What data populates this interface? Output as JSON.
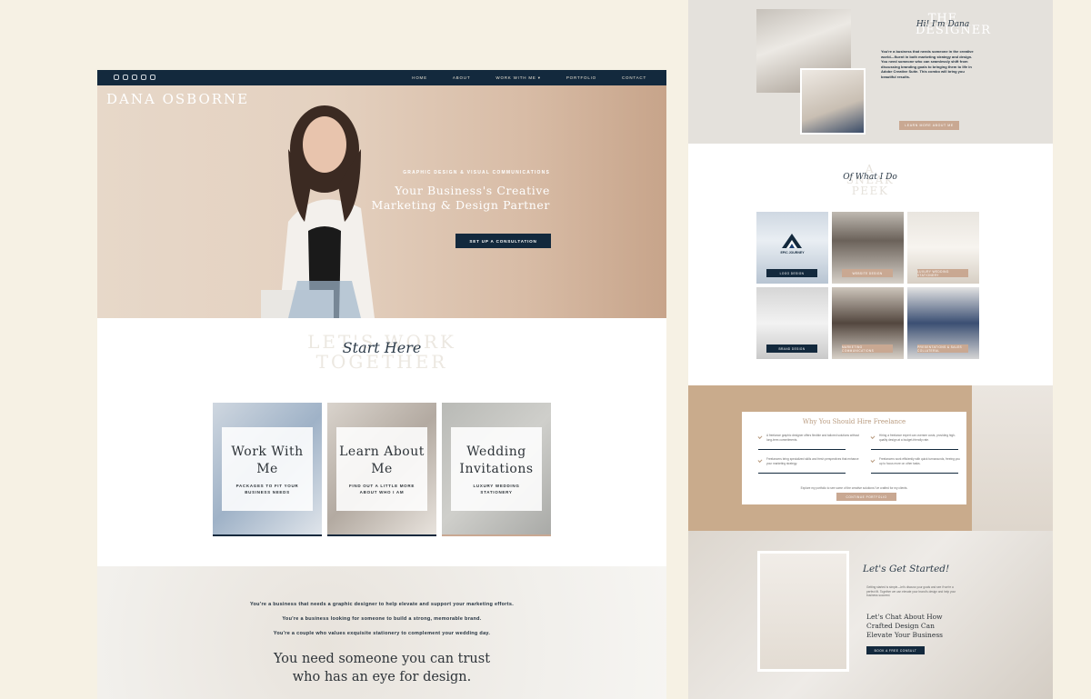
{
  "left_site": {
    "brand": "DANA OSBORNE",
    "nav": [
      "HOME",
      "ABOUT",
      "WORK WITH ME ▾",
      "PORTFOLIO",
      "CONTACT"
    ],
    "social_icons": [
      "instagram-icon",
      "pinterest-icon",
      "mail-icon",
      "facebook-icon",
      "tiktok-icon"
    ],
    "hero": {
      "kicker": "GRAPHIC DESIGN & VISUAL COMMUNICATIONS",
      "title": "Your Business's Creative Marketing & Design Partner",
      "button": "SET UP A CONSULTATION"
    },
    "start": {
      "big": "LET'S WORK TOGETHER",
      "script": "Start Here"
    },
    "cards": [
      {
        "title": "Work With Me",
        "sub": "PACKAGES TO FIT YOUR BUSINESS NEEDS"
      },
      {
        "title": "Learn About Me",
        "sub": "FIND OUT A LITTLE MORE ABOUT WHO I AM"
      },
      {
        "title": "Wedding Invitations",
        "sub": "LUXURY WEDDING STATIONERY"
      }
    ],
    "bottom": {
      "line1": "You're a business that needs a graphic designer to help elevate and support your marketing efforts.",
      "line2": "You're a business looking for someone to build a strong, memorable brand.",
      "line3": "You're a couple who values exquisite stationery to complement your wedding day.",
      "quote": "You need someone you can trust who has an eye for design."
    }
  },
  "right_site": {
    "about": {
      "title": "THE DESIGNER",
      "script": "Hi! I'm Dana",
      "text": "You're a business that needs someone in the creative world—fluent in both marketing strategy and design. You need someone who can seamlessly shift from discussing branding goals to bringing them to life in Adobe Creative Suite. This combo will bring you beautiful results.",
      "button": "LEARN MORE ABOUT ME"
    },
    "portfolio": {
      "title": "A SNEAK PEEK",
      "script": "Of What I Do",
      "items": [
        {
          "label": "LOGO DESIGN",
          "style": "dark"
        },
        {
          "label": "WEBSITE DESIGN",
          "style": "tan"
        },
        {
          "label": "LUXURY WEDDING STATIONERY",
          "style": "tan"
        },
        {
          "label": "BRAND DESIGN",
          "style": "dark"
        },
        {
          "label": "MARKETING COMMUNICATIONS",
          "style": "tan"
        },
        {
          "label": "PRESENTATIONS & SALES COLLATERAL",
          "style": "tan"
        }
      ],
      "logo_text": "EPIC JOURNEY"
    },
    "why": {
      "title": "Why You Should Hire Freelance",
      "items": [
        "A freelance graphic designer offers flexible and tailored solutions without long-term commitments.",
        "Hiring a freelance expert can oversee costs, providing high-quality design at a budget-friendly rate.",
        "Freelancers bring specialized skills and fresh perspectives that enhance your marketing strategy.",
        "Freelancers work efficiently with quick turnarounds, freeing you up to focus more on other tasks."
      ],
      "footer": "Explore my portfolio to see some of the creative solutions I've crafted for my clients.",
      "button": "CONTINUE PORTFOLIO"
    },
    "start": {
      "script": "Let's Get Started!",
      "text": "Getting started is simple—let's discuss your goals and see if we're a perfect fit. Together we can elevate your brand's design and help your business succeed.",
      "title": "Let's Chat About How Crafted Design Can Elevate Your Business",
      "button": "BOOK A FREE CONSULT"
    }
  },
  "colors": {
    "background": "#f6f1e4",
    "navy": "#13293d",
    "tan": "#c9a892",
    "gold": "#c9ab8c"
  }
}
